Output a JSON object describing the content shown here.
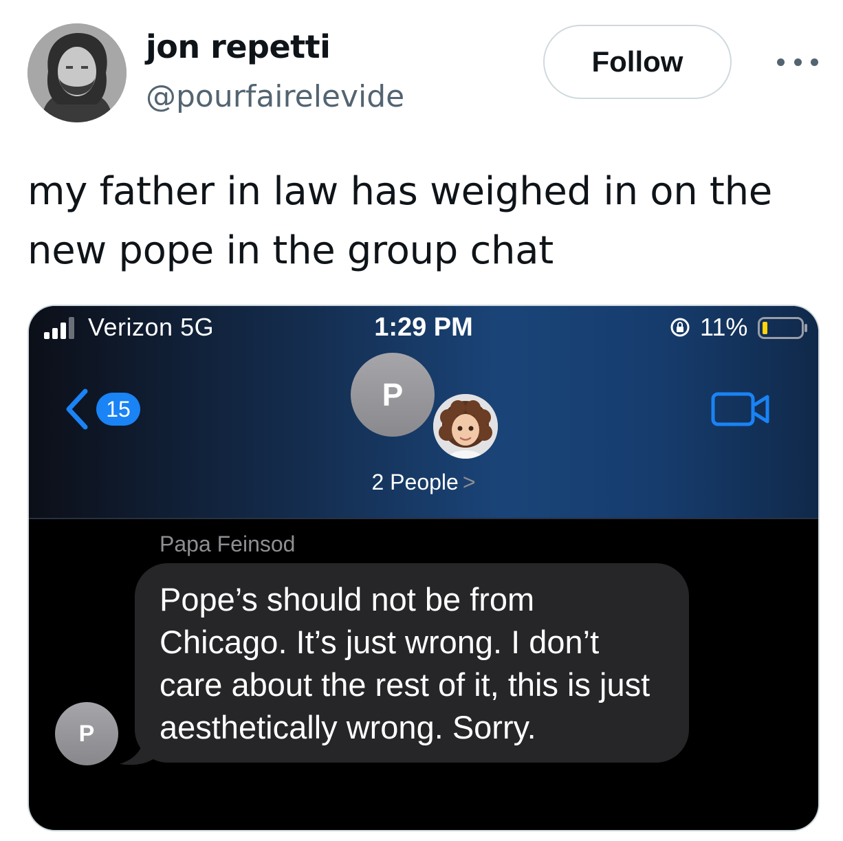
{
  "tweet": {
    "author": {
      "display_name": "jon repetti",
      "handle": "@pourfairelevide"
    },
    "follow_label": "Follow",
    "text": "my father in law has weighed in on the new pope in the group chat"
  },
  "phone": {
    "status_bar": {
      "carrier": "Verizon  5G",
      "time": "1:29 PM",
      "battery": "11%"
    },
    "nav": {
      "unread_count": "15",
      "group_avatar_initial": "P",
      "people_label": "2 People",
      "people_chevron": ">"
    },
    "conversation": {
      "sender_name": "Papa Feinsod",
      "sender_initial": "P",
      "message": "Pope’s should not be from Chicago. It’s just wrong. I don’t care about the rest of it, this is just aesthetically wrong. Sorry."
    },
    "colors": {
      "badge_blue": "#1a83f5",
      "bubble_gray": "#262629",
      "header_blue": "#1a4478"
    },
    "icons": [
      "signal-icon",
      "rotation-lock-icon",
      "battery-icon",
      "back-chevron-icon",
      "video-call-icon",
      "memoji-avatar"
    ]
  }
}
